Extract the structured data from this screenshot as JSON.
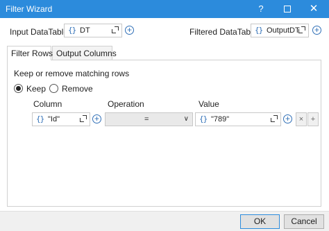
{
  "window": {
    "title": "Filter Wizard",
    "help_glyph": "?",
    "close_glyph": "✕"
  },
  "input_datatable": {
    "label": "Input DataTable",
    "brace": "{}",
    "value": "DT"
  },
  "filtered_datatable": {
    "label": "Filtered DataTable",
    "brace": "{}",
    "value": "OutputDT"
  },
  "tabs": [
    {
      "label": "Filter Rows",
      "active": true
    },
    {
      "label": "Output Columns",
      "active": false
    }
  ],
  "filter_rows": {
    "heading": "Keep or remove matching rows",
    "mode_options": [
      {
        "label": "Keep",
        "selected": true
      },
      {
        "label": "Remove",
        "selected": false
      }
    ],
    "columns": {
      "column": "Column",
      "operation": "Operation",
      "value": "Value"
    },
    "row": {
      "column_brace": "{}",
      "column_value": "\"Id\"",
      "operation_value": "=",
      "value_brace": "{}",
      "value_value": "\"789\""
    },
    "remove_glyph": "×",
    "add_glyph": "+"
  },
  "footer": {
    "ok_label": "OK",
    "cancel_label": "Cancel"
  },
  "colors": {
    "titlebar": "#2c8bdc",
    "brace_accent": "#2f6fb7"
  },
  "icons": [
    "help-icon",
    "maximize-icon",
    "close-icon",
    "expand-icon",
    "add-circle-icon",
    "chevron-down-icon",
    "remove-icon",
    "plus-icon"
  ]
}
